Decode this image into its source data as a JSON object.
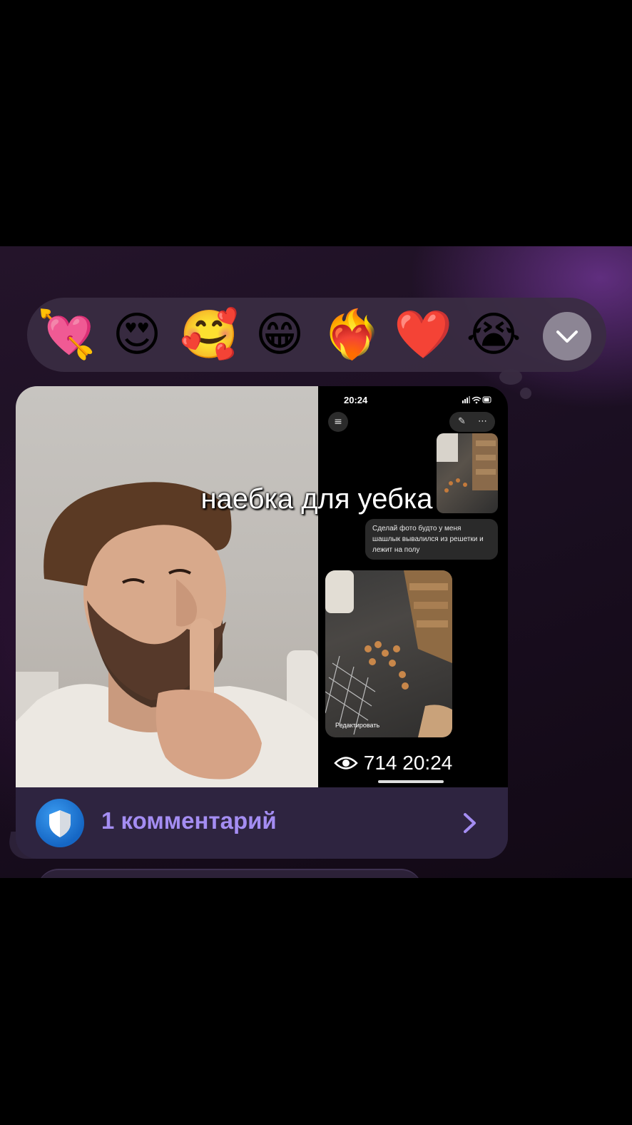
{
  "reactions": {
    "emojis": [
      "💘",
      "😍",
      "🥰",
      "😁",
      "❤️‍🔥",
      "❤️",
      "😭"
    ],
    "more_icon": "chevron-down-icon"
  },
  "post": {
    "caption": "наебка для уебка",
    "phone": {
      "time": "20:24",
      "status_icons": "signal wifi battery",
      "user_message": "Сделай фото будто у меня шашлык вывалился из решетки и лежит на полу",
      "edit_label": "Редактировать"
    },
    "views": "714",
    "time": "20:24"
  },
  "comments": {
    "label": "1 комментарий",
    "avatar_icon": "shield-icon",
    "arrow_icon": "chevron-right-icon"
  },
  "colors": {
    "bubble": "#2c2138",
    "accent": "#a48df2",
    "reaction_bar": "#3a2c42"
  }
}
